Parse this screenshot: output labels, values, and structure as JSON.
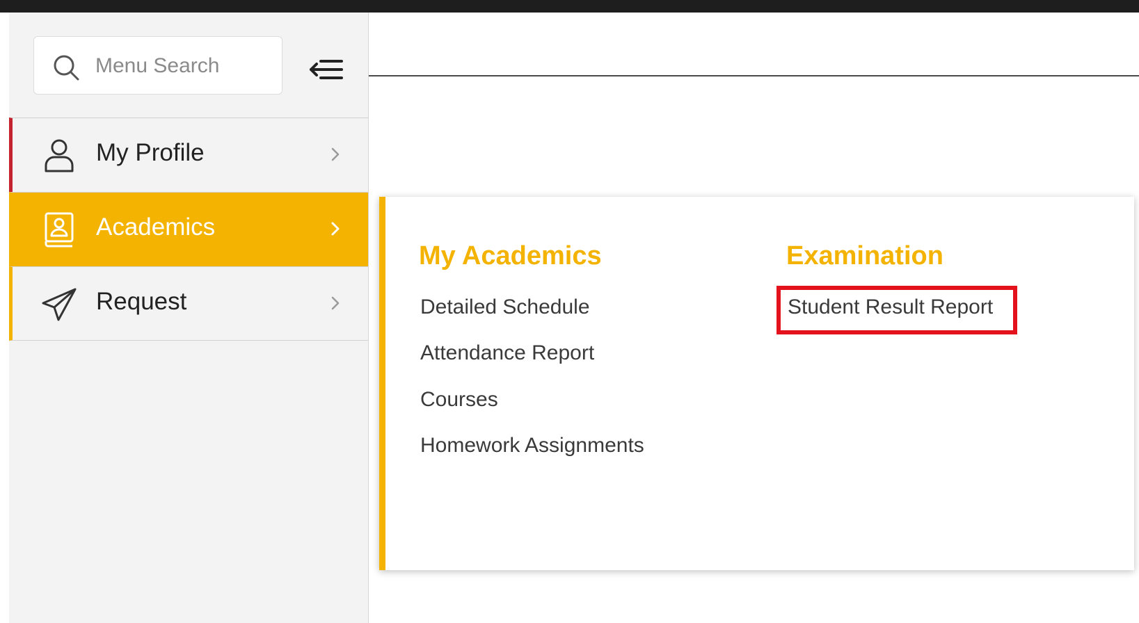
{
  "search": {
    "placeholder": "Menu Search",
    "value": ""
  },
  "sidebar": {
    "items": [
      {
        "label": "My Profile",
        "icon": "user-icon"
      },
      {
        "label": "Academics",
        "icon": "academics-book-icon",
        "active": true
      },
      {
        "label": "Request",
        "icon": "paper-plane-icon"
      }
    ]
  },
  "flyout": {
    "my_academics": {
      "title": "My Academics",
      "links": [
        "Detailed Schedule",
        "Attendance Report",
        "Courses",
        "Homework Assignments"
      ]
    },
    "examination": {
      "title": "Examination",
      "links": [
        "Student Result Report"
      ]
    }
  },
  "colors": {
    "accent": "#f3b300",
    "profile_marker": "#c5222f",
    "highlight": "#e3121c",
    "topbar": "#1e1e1e"
  }
}
